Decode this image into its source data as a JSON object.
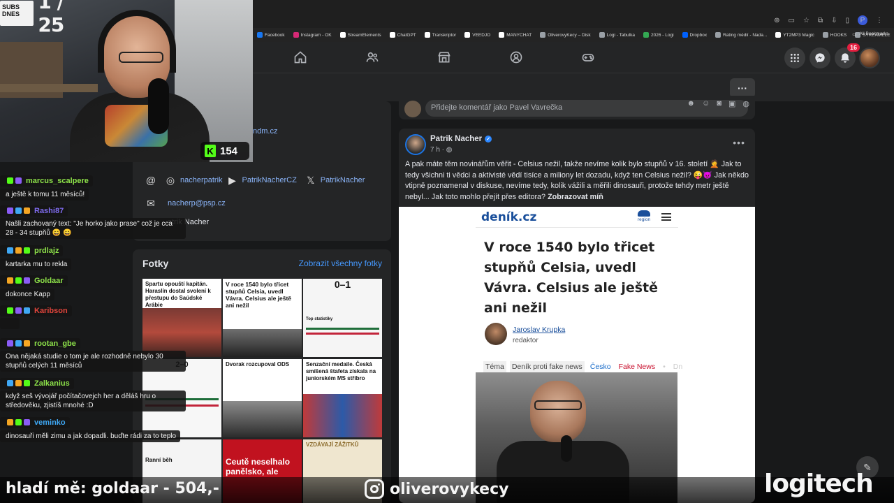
{
  "browser": {
    "bookmarks": [
      {
        "label": "Facebook",
        "color": "#1877f2"
      },
      {
        "label": "Instagram - OK",
        "color": "#d62976"
      },
      {
        "label": "StreamElements",
        "color": "#ffffff"
      },
      {
        "label": "ChatGPT",
        "color": "#ffffff"
      },
      {
        "label": "Transkriptor",
        "color": "#ffffff"
      },
      {
        "label": "VEEDJO",
        "color": "#ffffff"
      },
      {
        "label": "MANYCHAT",
        "color": "#ffffff"
      },
      {
        "label": "OliverovyKecy – Disk",
        "color": "#9aa0a6"
      },
      {
        "label": "Logi - Tabulka",
        "color": "#9aa0a6"
      },
      {
        "label": "2026 - Logi",
        "color": "#34a853"
      },
      {
        "label": "Dropbox",
        "color": "#0061fe"
      },
      {
        "label": "Rating médií - Nada...",
        "color": "#9aa0a6"
      },
      {
        "label": "YT2MP3 Magic",
        "color": "#ffffff"
      },
      {
        "label": "HOOKS",
        "color": "#9aa0a6"
      },
      {
        "label": "STREAMELE",
        "color": "#9aa0a6"
      }
    ],
    "all_bookmarks": "All Bookmarks",
    "profile_initial": "P"
  },
  "fb_nav": {
    "notifications_count": "16"
  },
  "profile": {
    "website_fragment": "ndm.cz",
    "instagram_handle": "nacherpatrik",
    "youtube_handle": "PatrikNacherCZ",
    "x_handle": "PatrikNacher",
    "email": "nacherp@psp.cz",
    "name_fragment": "atrik Nacher",
    "photos_title": "Fotky",
    "photos_all": "Zobrazit všechny fotky",
    "photo_tiles": [
      {
        "title": "Spartu opouští kapitán. Haraslín dostal svolení k přestupu do Saúdské Arábie"
      },
      {
        "title": "V roce 1540 bylo třicet stupňů Celsia, uvedl Vávra. Celsius ale ještě ani nežil"
      },
      {
        "title": "Top statistiky"
      },
      {
        "title": "2–0"
      },
      {
        "title": "Dvorak rozcupoval ODS"
      },
      {
        "title": "Senzační medaile. Česká smíšená štafeta získala na juniorském MS stříbro"
      },
      {
        "title": "Ranní běh"
      },
      {
        "title": "Ceutě neselhalo panělsko, ale"
      },
      {
        "title": "VZDÁVAJÍ ZÁŽITKŮ"
      }
    ],
    "photo_score": "0–1"
  },
  "comment_placeholder": "Přidejte komentář jako Pavel Vavrečka",
  "post": {
    "author": "Patrik Nacher",
    "time": "7 h ·",
    "text": "A pak máte těm novinářům věřit - Celsius nežil, takže nevíme kolik bylo stupňů v 16. století 🤦 Jak to tedy všichni ti vědci a aktivisté vědí tisíce a miliony let dozadu, když ten Celsius nežil? 😜😈 Jak někdo vtipně poznamenal v diskuse, nevíme tedy, kolik vážili a měřili dinosauři, protože tehdy metr ještě nebyl... Jak toto mohlo přejít přes editora?",
    "see_less": "Zobrazovat míň",
    "article": {
      "logo": "deník.cz",
      "region": "region",
      "headline": "V roce 1540 bylo třicet stupňů Celsia, uvedl Vávra. Celsius ale ještě ani nežil",
      "author": "Jaroslav Krupka",
      "role": "redaktor",
      "tags": [
        "Téma",
        "Deník proti fake news",
        "Česko",
        "Fake News",
        "•",
        "Dn"
      ]
    }
  },
  "stream": {
    "subs_label": "SUBS DNES",
    "subs_count": "1 / 25",
    "kick_viewers": "154",
    "chat": [
      {
        "user": "marcus_scalpere",
        "color": "#8ee34a",
        "text": "a ještě k tomu 11 měsíců!"
      },
      {
        "user": "Rashi87",
        "color": "#7f6cf0",
        "text": "Našli zachovaný text: \"Je horko jako prase\" což je cca 28 - 34 stupňů 😄 😄"
      },
      {
        "user": "prdlajz",
        "color": "#8ee34a",
        "text": "kartarka mu to rekla"
      },
      {
        "user": "Goldaar",
        "color": "#8ee34a",
        "text": "dokonce Kapp"
      },
      {
        "user": "Karibson",
        "color": "#e2453c",
        "text": ""
      },
      {
        "user": "rootan_gbe",
        "color": "#8ee34a",
        "text": "Ona nějaká studie o tom je ale rozhodně nebylo 30 stupňů celých 11 měsíců"
      },
      {
        "user": "Zalkanius",
        "color": "#8ee34a",
        "text": "když seš vývojář počítačovejch her a děláš hru o středověku, zjistíš mnohé :D"
      },
      {
        "user": "veminko",
        "color": "#3fa8f5",
        "text": "dinosauři měli zimu a jak dopadli. buďte rádi za to teplo"
      }
    ],
    "ticker": "hladí mě: goldaar - 504,-",
    "instagram": "oliverovykecy",
    "sponsor": "logitech"
  }
}
